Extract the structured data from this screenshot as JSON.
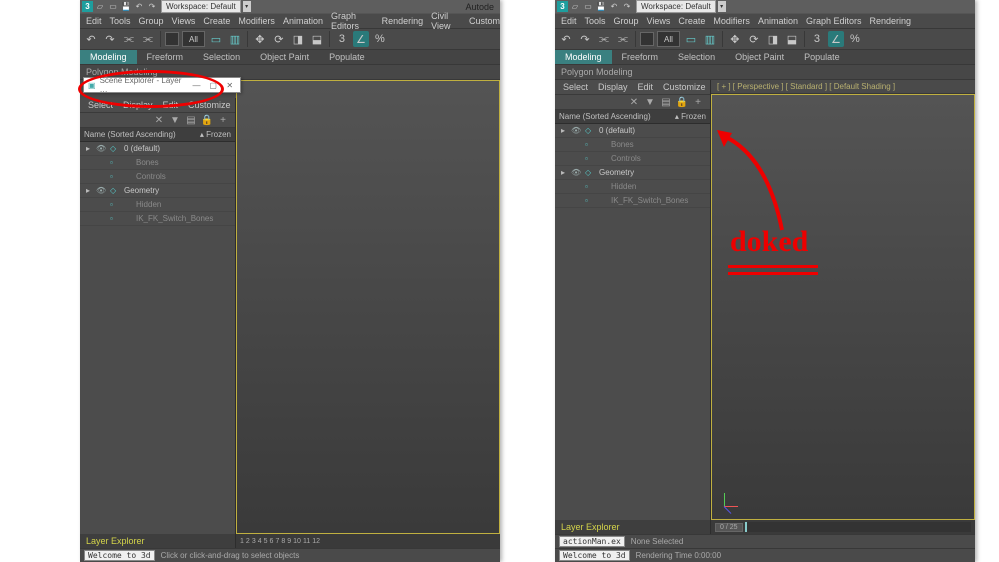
{
  "workspace_label": "Workspace: Default",
  "app_title": "Autode",
  "menubar": [
    "Edit",
    "Tools",
    "Group",
    "Views",
    "Create",
    "Modifiers",
    "Animation",
    "Graph Editors",
    "Rendering",
    "Civil View",
    "Custom"
  ],
  "toolbar": {
    "sel_filter": "All"
  },
  "ribbon_tabs": {
    "active": "Modeling",
    "others": [
      "Freeform",
      "Selection",
      "Object Paint",
      "Populate"
    ]
  },
  "ribbon_panel": "Polygon Modeling",
  "scene_explorer": {
    "float_title": "Scene Explorer - Layer …",
    "menus": [
      "Select",
      "Display",
      "Edit",
      "Customize"
    ],
    "header": {
      "col1": "Name (Sorted Ascending)",
      "col2": "▴ Frozen"
    },
    "rows": [
      {
        "type": "layer",
        "name": "0 (default)",
        "expand": true
      },
      {
        "type": "item",
        "name": "Bones"
      },
      {
        "type": "item",
        "name": "Controls"
      },
      {
        "type": "layer",
        "name": "Geometry",
        "expand": true
      },
      {
        "type": "item",
        "name": "Hidden"
      },
      {
        "type": "item",
        "name": "IK_FK_Switch_Bones"
      }
    ],
    "footer": "Layer Explorer"
  },
  "viewport_label": "[ + ] [ Perspective ] [ Standard ] [ Default Shading ]",
  "timeline": {
    "frame": "0 / 25"
  },
  "status_left": {
    "welcome": "Welcome to 3d",
    "hint": "Click or click-and-drag to select objects"
  },
  "status_right": {
    "script": "actionMan.ex",
    "welcome": "Welcome to 3d",
    "sel": "None Selected",
    "rt": "Rendering Time  0:00:00"
  },
  "annotation": "doked"
}
